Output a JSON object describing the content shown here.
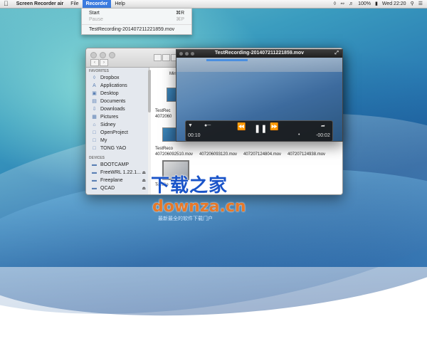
{
  "menubar": {
    "apple": "",
    "app_name": "Screen Recorder air",
    "menus": [
      "File",
      "Recorder",
      "Help"
    ],
    "active_menu": "Recorder",
    "status": {
      "battery": "100%",
      "datetime": "Wed 22:20"
    }
  },
  "recorder_menu": {
    "items": [
      {
        "label": "Start",
        "shortcut": "⌘R",
        "enabled": true
      },
      {
        "label": "Pause",
        "shortcut": "⌘P",
        "enabled": false
      }
    ],
    "recent": "TestRecording-201407211221859.mov"
  },
  "finder": {
    "sidebar": {
      "favorites_header": "FAVORITES",
      "favorites": [
        "Dropbox",
        "Applications",
        "Desktop",
        "Documents",
        "Downloads",
        "Pictures",
        "Sidney",
        "OpenProject",
        "My",
        "TONG YAO"
      ],
      "devices_header": "DEVICES",
      "devices": [
        "BOOTCAMP",
        "FreeWRL 1.22.1...",
        "Freeplane",
        "QCAD"
      ]
    },
    "files": {
      "top_label": "Mirr",
      "row1": [
        "TestRec",
        "4072060"
      ],
      "row2a": [
        "TestReco",
        "407206092510.mov"
      ],
      "row2b": "407206093120.mov",
      "row2c": "407207124804.mov",
      "row2d": "407207124938.mov",
      "selected_label": "TestRe"
    }
  },
  "player": {
    "title": "TestRecording-201407211221859.mov",
    "elapsed": "00:10",
    "remaining": "-00:02"
  },
  "watermark": {
    "brand_cn": "下载之家",
    "domain": "downza.cn",
    "tagline": "最新最全的软件下载门户"
  }
}
